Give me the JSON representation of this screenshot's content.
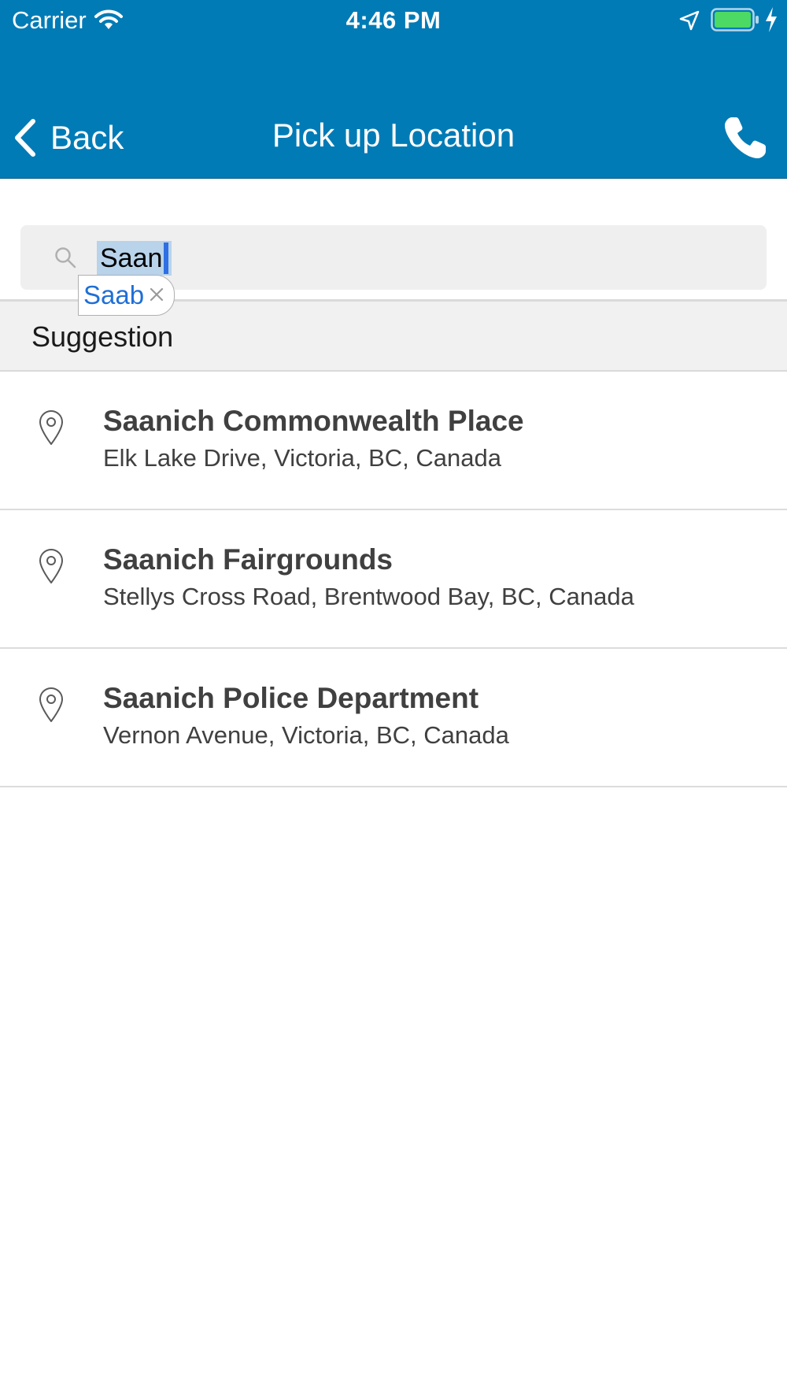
{
  "status_bar": {
    "carrier": "Carrier",
    "time": "4:46 PM",
    "icons": [
      "wifi-icon",
      "location-arrow-icon",
      "battery-icon",
      "charging-icon"
    ],
    "battery_color": "#4cd964"
  },
  "nav": {
    "back_label": "Back",
    "title": "Pick up Location",
    "right_icon": "phone-icon",
    "background_color": "#007bb6"
  },
  "search": {
    "value": "Saan",
    "autocorrect_suggestion": "Saab"
  },
  "section": {
    "label": "Suggestion"
  },
  "results": [
    {
      "title": "Saanich Commonwealth Place",
      "subtitle": "Elk Lake Drive, Victoria, BC, Canada",
      "icon": "map-pin-icon"
    },
    {
      "title": "Saanich Fairgrounds",
      "subtitle": "Stellys Cross Road, Brentwood Bay, BC, Canada",
      "icon": "map-pin-icon"
    },
    {
      "title": "Saanich Police Department",
      "subtitle": "Vernon Avenue, Victoria, BC, Canada",
      "icon": "map-pin-icon"
    }
  ]
}
